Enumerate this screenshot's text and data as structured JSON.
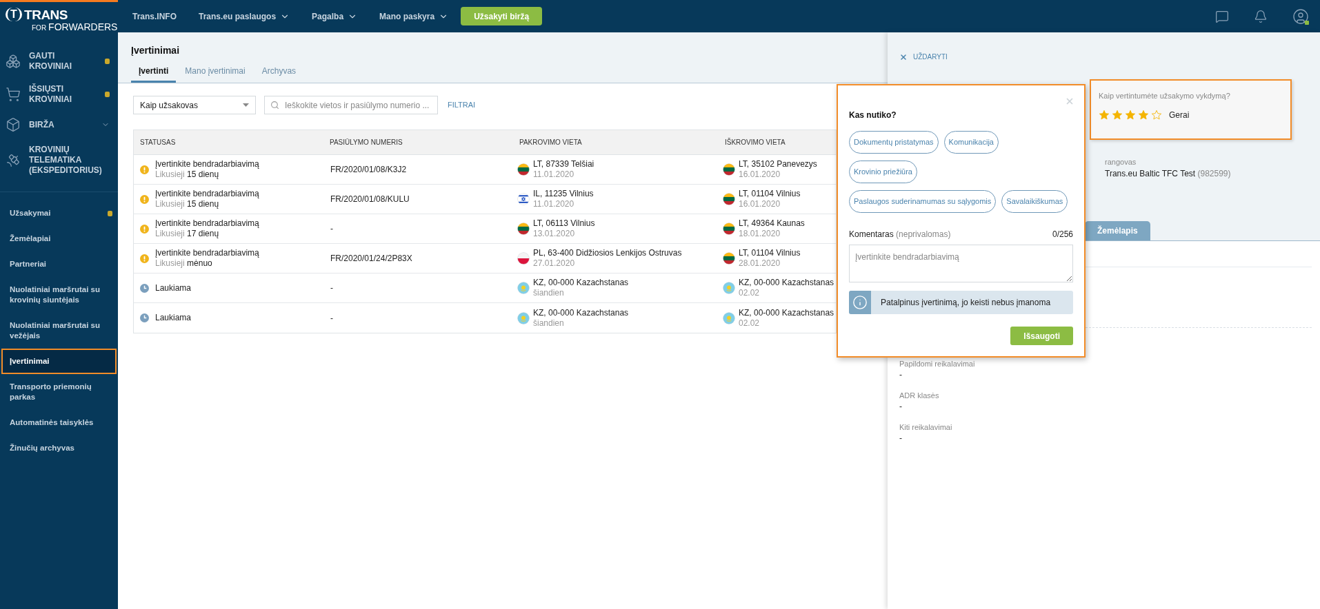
{
  "logo": {
    "mark": "T",
    "name": "TRANS",
    "prefix": "FOR",
    "sub": "FORWARDERS"
  },
  "top_nav": [
    {
      "label": "Trans.INFO",
      "dropdown": false
    },
    {
      "label": "Trans.eu paslaugos",
      "dropdown": true
    },
    {
      "label": "Pagalba",
      "dropdown": true
    },
    {
      "label": "Mano paskyra",
      "dropdown": true
    }
  ],
  "order_button": "Užsakyti biržą",
  "sidebar": {
    "primary": [
      {
        "label": "GAUTI KROVINIAI",
        "kind": "boxes",
        "notification": true
      },
      {
        "label": "IŠSIŲSTI KROVINIAI",
        "kind": "cart",
        "notification": true
      },
      {
        "label": "BIRŽA",
        "kind": "cube",
        "expandable": true
      },
      {
        "label": "KROVINIŲ TELEMATIKA (EKSPEDITORIUS)",
        "kind": "satellite"
      }
    ],
    "secondary": [
      {
        "label": "Užsakymai",
        "notification": true,
        "selected": false,
        "highlighted": false
      },
      {
        "label": "Žemėlapiai",
        "notification": false,
        "selected": false,
        "highlighted": false
      },
      {
        "label": "Partneriai",
        "notification": false,
        "selected": false,
        "highlighted": false
      },
      {
        "label": "Nuolatiniai maršrutai su krovinių siuntėjais",
        "notification": false,
        "selected": false,
        "highlighted": false
      },
      {
        "label": "Nuolatiniai maršrutai su vežėjais",
        "notification": false,
        "selected": false,
        "highlighted": false
      },
      {
        "label": "Įvertinimai",
        "notification": false,
        "selected": true,
        "highlighted": true
      },
      {
        "label": "Transporto priemonių parkas",
        "notification": false,
        "selected": false,
        "highlighted": false
      },
      {
        "label": "Automatinės taisyklės",
        "notification": false,
        "selected": false,
        "highlighted": false
      },
      {
        "label": "Žinučių archyvas",
        "notification": false,
        "selected": false,
        "highlighted": false
      }
    ]
  },
  "page": {
    "title": "Įvertinimai",
    "tabs": [
      {
        "label": "Įvertinti",
        "selected": true
      },
      {
        "label": "Mano įvertinimai",
        "selected": false
      },
      {
        "label": "Archyvas",
        "selected": false
      }
    ],
    "role_select": {
      "value": "Kaip užsakovas"
    },
    "search": {
      "placeholder": "Ieškokite vietos ir pasiūlymo numerio ..."
    },
    "filters": "FILTRAI",
    "table": {
      "columns": [
        "STATUSAS",
        "PASIŪLYMO NUMERIS",
        "PAKROVIMO VIETA",
        "IŠKROVIMO VIETA"
      ],
      "rows": [
        {
          "kind": "warning",
          "status": "Įvertinkite bendradarbiavimą",
          "remaining_label": "Likusieji",
          "remaining": "15 dienų",
          "offer": "FR/2020/01/08/K3J2",
          "loading": {
            "kind": "lt",
            "place": "LT, 87339 Telšiai",
            "date": "11.01.2020"
          },
          "unloading": {
            "kind": "lt",
            "place": "LT, 35102 Panevezys",
            "date": "16.01.2020"
          }
        },
        {
          "kind": "warning",
          "status": "Įvertinkite bendradarbiavimą",
          "remaining_label": "Likusieji",
          "remaining": "15 dienų",
          "offer": "FR/2020/01/08/KULU",
          "loading": {
            "kind": "il",
            "place": "IL, 11235 Vilnius",
            "date": "11.01.2020"
          },
          "unloading": {
            "kind": "lt",
            "place": "LT, 01104 Vilnius",
            "date": "16.01.2020"
          }
        },
        {
          "kind": "warning",
          "status": "Įvertinkite bendradarbiavimą",
          "remaining_label": "Likusieji",
          "remaining": "17 dienų",
          "offer": "-",
          "loading": {
            "kind": "lt",
            "place": "LT, 06113 Vilnius",
            "date": "13.01.2020"
          },
          "unloading": {
            "kind": "lt",
            "place": "LT, 49364 Kaunas",
            "date": "18.01.2020"
          }
        },
        {
          "kind": "warning",
          "status": "Įvertinkite bendradarbiavimą",
          "remaining_label": "Likusieji",
          "remaining": "mėnuo",
          "offer": "FR/2020/01/24/2P83X",
          "loading": {
            "kind": "pl",
            "place": "PL, 63-400 Didžiosios Lenkijos Ostruvas",
            "date": "27.01.2020"
          },
          "unloading": {
            "kind": "lt",
            "place": "LT, 01104 Vilnius",
            "date": "28.01.2020"
          }
        },
        {
          "kind": "waiting",
          "status": "Laukiama",
          "offer": "-",
          "loading": {
            "kind": "kz",
            "place": "KZ, 00-000 Kazachstanas",
            "date": "šiandien"
          },
          "unloading": {
            "kind": "kz",
            "place": "KZ, 00-000 Kazachstanas",
            "date": "02.02"
          }
        },
        {
          "kind": "waiting",
          "status": "Laukiama",
          "offer": "-",
          "loading": {
            "kind": "kz",
            "place": "KZ, 00-000 Kazachstanas",
            "date": "šiandien"
          },
          "unloading": {
            "kind": "kz",
            "place": "KZ, 00-000 Kazachstanas",
            "date": "02.02"
          }
        }
      ]
    }
  },
  "detail": {
    "close": "UŽDARYTI",
    "rating": {
      "question": "Kaip vertintumėte užsakymo vykdymą?",
      "stars": 4,
      "verdict": "Gerai",
      "highlighted": true
    },
    "contractor": {
      "label": "rangovas",
      "name": "Trans.eu Baltic TFC Test",
      "id": "(982599)"
    },
    "map_tab": "Žemėlapis",
    "fields": [
      {
        "label": "Papildomi reikalavimai",
        "value": "-"
      },
      {
        "label": "ADR klasės",
        "value": "-"
      },
      {
        "label": "Kiti reikalavimai",
        "value": "-"
      }
    ]
  },
  "popup": {
    "highlighted": true,
    "title": "Kas nutiko?",
    "reasons": [
      {
        "label": "Dokumentų pristatymas",
        "selected": false
      },
      {
        "label": "Komunikacija",
        "selected": false
      },
      {
        "label": "Krovinio priežiūra",
        "selected": false
      },
      {
        "label": "Paslaugos suderinamumas su sąlygomis",
        "selected": false
      },
      {
        "label": "Savalaikiškumas",
        "selected": false
      }
    ],
    "comment_label": "Komentaras",
    "comment_hint": "(neprivalomas)",
    "counter": "0/256",
    "comment_placeholder": "Įvertinkite bendradarbiavimą",
    "info": "Patalpinus įvertinimą, jo keisti nebus įmanoma",
    "save": "Išsaugoti"
  }
}
